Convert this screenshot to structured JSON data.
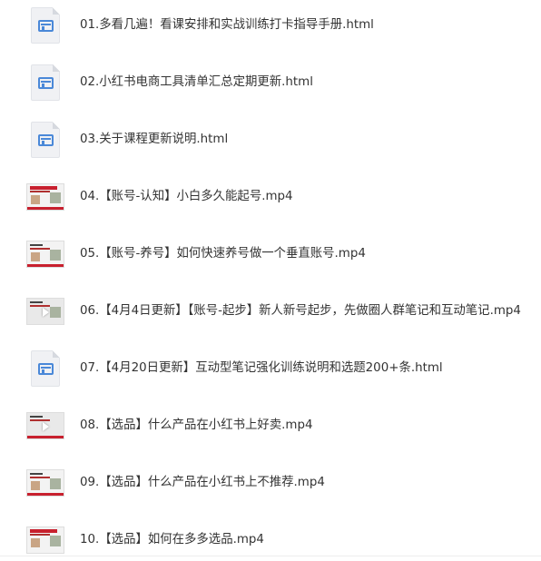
{
  "files": [
    {
      "name": "01.多看几遍！看课安排和实战训练打卡指导手册.html",
      "icon": "html-file-icon"
    },
    {
      "name": "02.小红书电商工具清单汇总定期更新.html",
      "icon": "html-file-icon"
    },
    {
      "name": "03.关于课程更新说明.html",
      "icon": "html-file-icon"
    },
    {
      "name": "04.【账号-认知】小白多久能起号.mp4",
      "icon": "video-thumbnail"
    },
    {
      "name": "05.【账号-养号】如何快速养号做一个垂直账号.mp4",
      "icon": "video-thumbnail"
    },
    {
      "name": "06.【4月4日更新】【账号-起步】新人新号起步，先做圈人群笔记和互动笔记.mp4",
      "icon": "video-thumbnail"
    },
    {
      "name": "07.【4月20日更新】互动型笔记强化训练说明和选题200+条.html",
      "icon": "html-file-icon"
    },
    {
      "name": "08.【选品】什么产品在小红书上好卖.mp4",
      "icon": "video-thumbnail"
    },
    {
      "name": "09.【选品】什么产品在小红书上不推荐.mp4",
      "icon": "video-thumbnail"
    },
    {
      "name": "10.【选品】如何在多多选品.mp4",
      "icon": "video-thumbnail"
    }
  ],
  "colors": {
    "icon_blue": "#4a88d8",
    "thumb_red": "#c8202e",
    "text": "#333333"
  }
}
